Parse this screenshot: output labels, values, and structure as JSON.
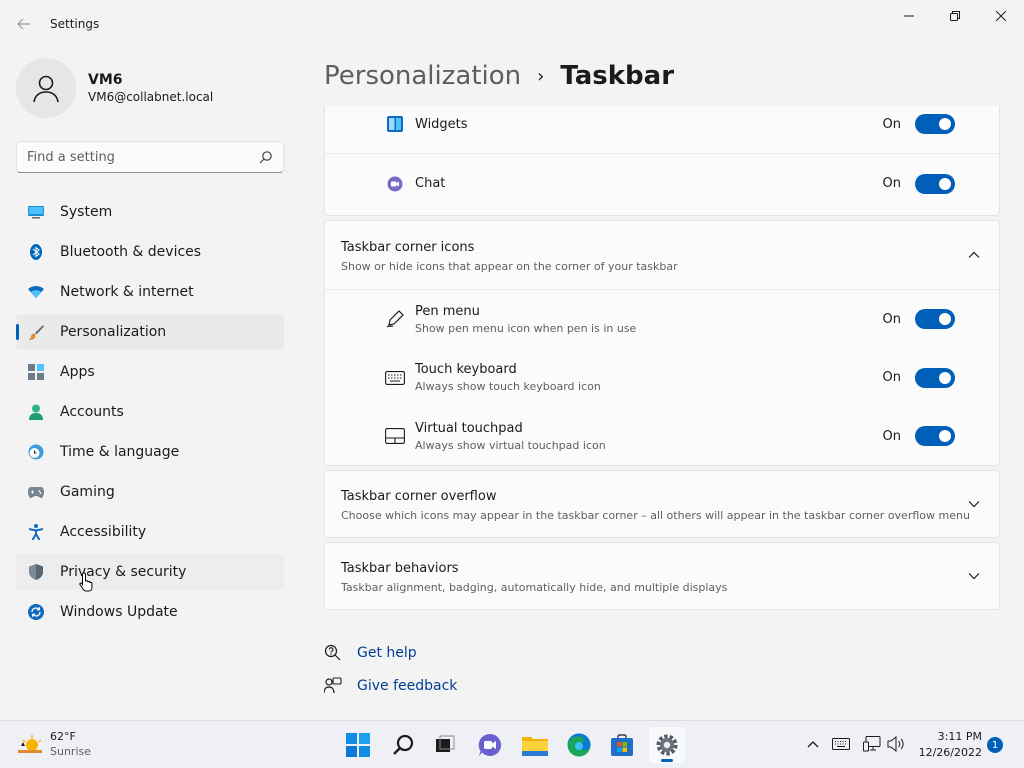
{
  "window": {
    "title": "Settings",
    "back_icon": "arrow-left-icon",
    "controls": {
      "minimize": "─",
      "maximize": "❐",
      "close": "✕"
    }
  },
  "user": {
    "name": "VM6",
    "email": "VM6@collabnet.local"
  },
  "search": {
    "placeholder": "Find a setting"
  },
  "nav": [
    {
      "label": "System",
      "icon": "monitor-icon"
    },
    {
      "label": "Bluetooth & devices",
      "icon": "bluetooth-icon"
    },
    {
      "label": "Network & internet",
      "icon": "wifi-icon"
    },
    {
      "label": "Personalization",
      "icon": "paintbrush-icon",
      "active": true
    },
    {
      "label": "Apps",
      "icon": "apps-icon"
    },
    {
      "label": "Accounts",
      "icon": "person-icon"
    },
    {
      "label": "Time & language",
      "icon": "clock-globe-icon"
    },
    {
      "label": "Gaming",
      "icon": "gamepad-icon"
    },
    {
      "label": "Accessibility",
      "icon": "accessibility-icon"
    },
    {
      "label": "Privacy & security",
      "icon": "shield-icon",
      "hover": true
    },
    {
      "label": "Windows Update",
      "icon": "update-icon"
    }
  ],
  "breadcrumb": {
    "parent": "Personalization",
    "separator": "›",
    "current": "Taskbar"
  },
  "taskbar_items": [
    {
      "title": "Widgets",
      "state": "On",
      "icon": "widgets-icon"
    },
    {
      "title": "Chat",
      "state": "On",
      "icon": "chat-icon"
    }
  ],
  "corner_icons": {
    "title": "Taskbar corner icons",
    "description": "Show or hide icons that appear on the corner of your taskbar",
    "expanded": true,
    "items": [
      {
        "title": "Pen menu",
        "description": "Show pen menu icon when pen is in use",
        "state": "On",
        "icon": "pen-icon"
      },
      {
        "title": "Touch keyboard",
        "description": "Always show touch keyboard icon",
        "state": "On",
        "icon": "keyboard-icon"
      },
      {
        "title": "Virtual touchpad",
        "description": "Always show virtual touchpad icon",
        "state": "On",
        "icon": "touchpad-icon"
      }
    ]
  },
  "corner_overflow": {
    "title": "Taskbar corner overflow",
    "description": "Choose which icons may appear in the taskbar corner – all others will appear in the taskbar corner overflow menu"
  },
  "behaviors": {
    "title": "Taskbar behaviors",
    "description": "Taskbar alignment, badging, automatically hide, and multiple displays"
  },
  "links": {
    "help": "Get help",
    "feedback": "Give feedback"
  },
  "os_taskbar": {
    "weather": {
      "temp": "62°F",
      "condition": "Sunrise"
    },
    "apps": [
      "start-icon",
      "search-icon",
      "task-view-icon",
      "chat-icon",
      "file-explorer-icon",
      "edge-icon",
      "store-icon",
      "settings-icon"
    ],
    "clock": {
      "time": "3:11 PM",
      "date": "12/26/2022"
    },
    "notifications": "1"
  },
  "colors": {
    "accent": "#005fb8",
    "background": "#f3f3f3",
    "card": "#fbfbfb"
  }
}
